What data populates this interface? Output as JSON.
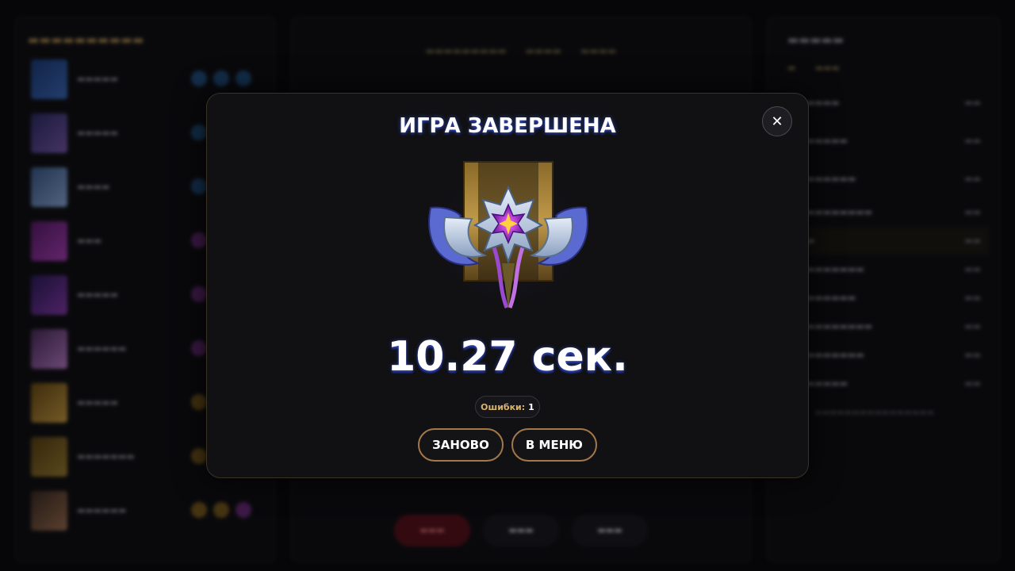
{
  "modal": {
    "title": "ИГРА ЗАВЕРШЕНА",
    "close_symbol": "✕",
    "medal_icon": "divine-rank-medal-icon",
    "time_text": "10.27 сек.",
    "errors_label": "Ошибки:",
    "errors_value": "1",
    "buttons": {
      "restart": "ЗАНОВО",
      "menu": "В МЕНЮ"
    }
  },
  "colors": {
    "modal_border": "#3a3222",
    "button_border": "#a2784a",
    "errors_label": "#d9b36a",
    "title_glow": "#466eff"
  }
}
